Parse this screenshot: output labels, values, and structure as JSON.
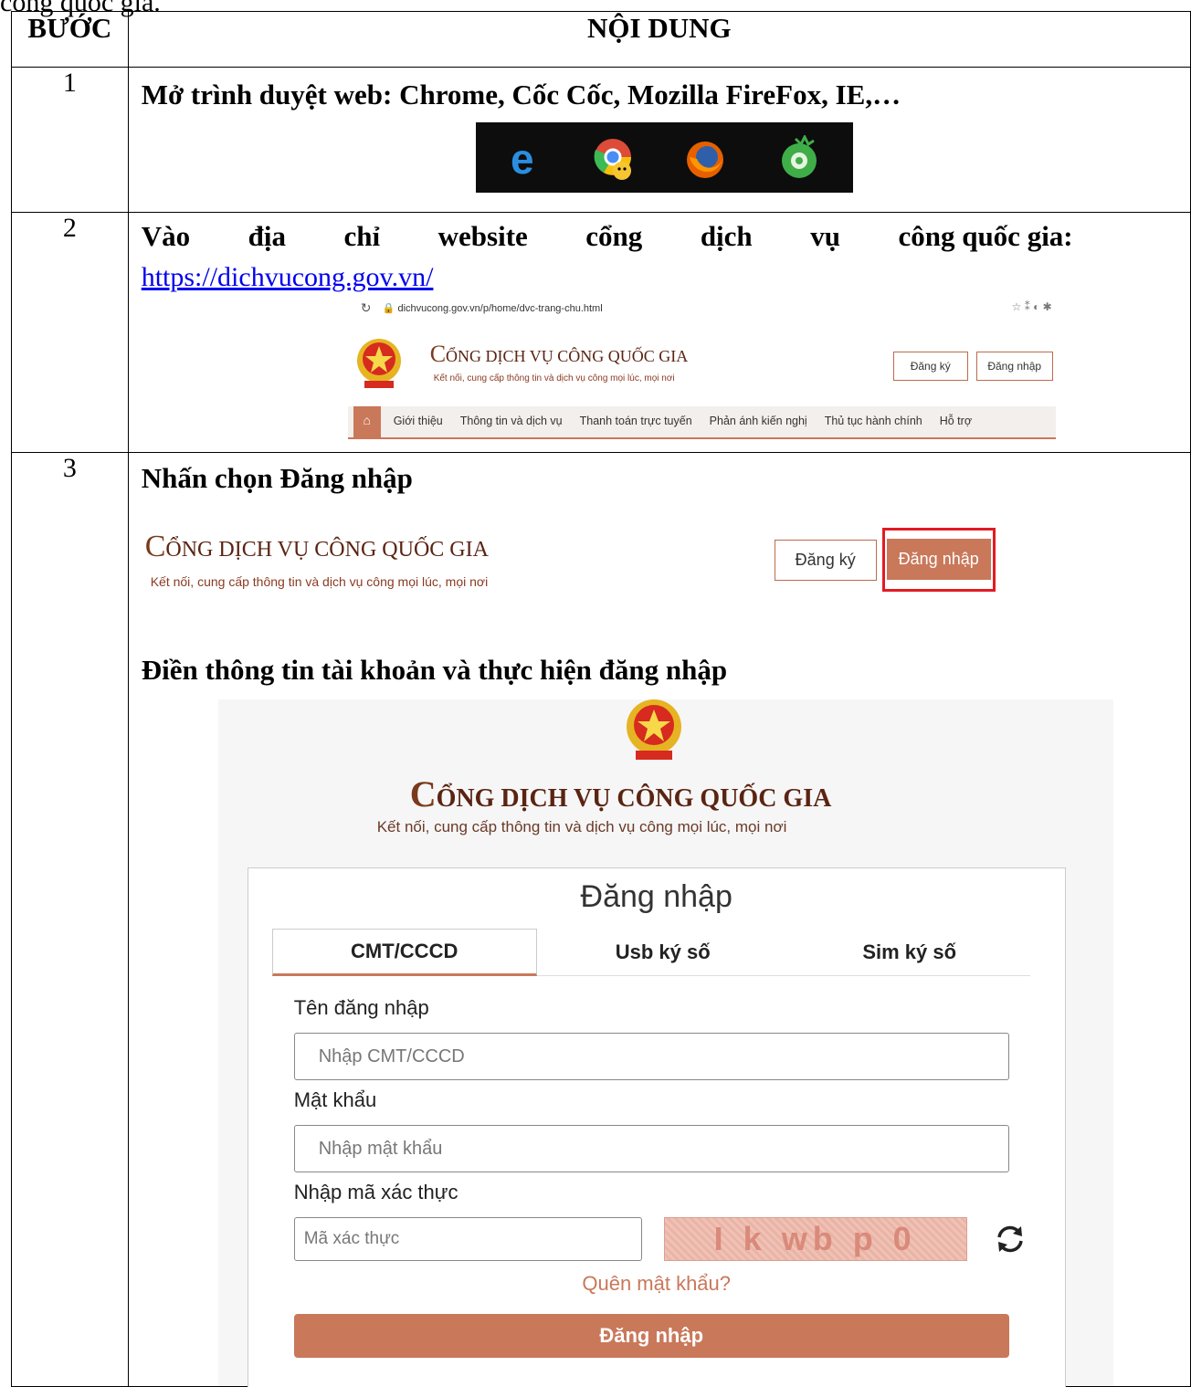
{
  "top_line": "công quốc gia.",
  "table": {
    "col_step": "BƯỚC",
    "col_content": "NỘI DUNG"
  },
  "step1": {
    "num": "1",
    "text": "Mở trình duyệt web: Chrome, Cốc Cốc, Mozilla FireFox, IE,…",
    "icons": [
      "ie-icon",
      "chrome-icon",
      "firefox-icon",
      "coccoc-icon"
    ]
  },
  "step2": {
    "num": "2",
    "text_words": [
      "Vào",
      "địa",
      "chỉ",
      "website",
      "cổng",
      "dịch",
      "vụ",
      "công quốc gia:"
    ],
    "link": "https://dichvucong.gov.vn/",
    "shot": {
      "address": "dichvucong.gov.vn/p/home/dvc-trang-chu.html",
      "site_title": "ỔNG DỊCH VỤ CÔNG QUỐC GIA",
      "site_sub": "Kết nối, cung cấp thông tin và dịch vụ công mọi lúc, mọi nơi",
      "register": "Đăng ký",
      "login": "Đăng nhập",
      "nav": [
        "Giới thiệu",
        "Thông tin và dịch vụ",
        "Thanh toán trực tuyến",
        "Phản ánh kiến nghị",
        "Thủ tục hành chính",
        "Hỗ trợ"
      ]
    }
  },
  "step3": {
    "num": "3",
    "heading1": "Nhấn chọn Đăng nhập",
    "site_title": "ỔNG DỊCH VỤ CÔNG QUỐC GIA",
    "site_sub": "Kết nối, cung cấp thông tin và dịch vụ công mọi lúc, mọi nơi",
    "register": "Đăng ký",
    "login": "Đăng nhập",
    "heading2": "Điền thông tin tài khoản và thực hiện đăng nhập",
    "form": {
      "site_title": "ỔNG DỊCH VỤ CÔNG QUỐC GIA",
      "site_sub": "Kết nối, cung cấp thông tin và dịch vụ công mọi lúc, mọi nơi",
      "title": "Đăng nhập",
      "tabs": [
        "CMT/CCCD",
        "Usb ký số",
        "Sim ký số"
      ],
      "username_label": "Tên đăng nhập",
      "username_placeholder": "Nhập CMT/CCCD",
      "password_label": "Mật khẩu",
      "password_placeholder": "Nhập mật khẩu",
      "captcha_label": "Nhập mã xác thực",
      "captcha_placeholder": "Mã xác thực",
      "captcha_text": "I k wb p 0",
      "forgot": "Quên mật khẩu?",
      "submit": "Đăng nhập"
    }
  },
  "colors": {
    "brand": "#c9785a",
    "highlight": "#e21b23",
    "dark_brand": "#5a2412"
  }
}
